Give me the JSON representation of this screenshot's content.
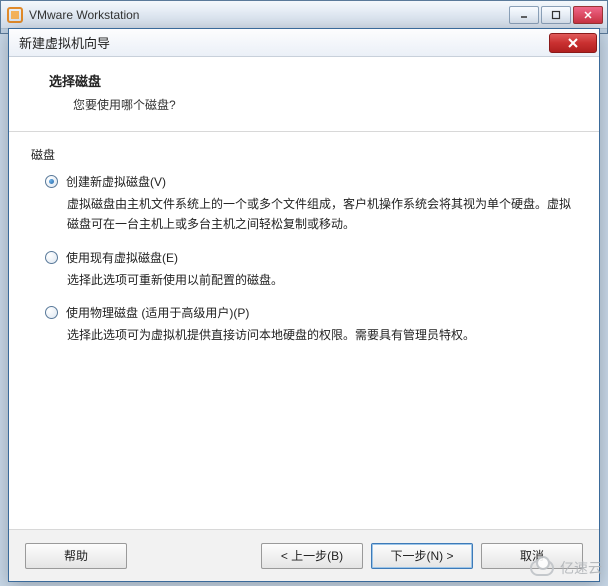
{
  "parent": {
    "title": "VMware Workstation"
  },
  "dialog": {
    "title": "新建虚拟机向导",
    "heading": "选择磁盘",
    "sub": "您要使用哪个磁盘?",
    "group_label": "磁盘",
    "options": [
      {
        "label": "创建新虚拟磁盘(V)",
        "desc": "虚拟磁盘由主机文件系统上的一个或多个文件组成，客户机操作系统会将其视为单个硬盘。虚拟磁盘可在一台主机上或多台主机之间轻松复制或移动。",
        "checked": true
      },
      {
        "label": "使用现有虚拟磁盘(E)",
        "desc": "选择此选项可重新使用以前配置的磁盘。",
        "checked": false
      },
      {
        "label": "使用物理磁盘 (适用于高级用户)(P)",
        "desc": "选择此选项可为虚拟机提供直接访问本地硬盘的权限。需要具有管理员特权。",
        "checked": false
      }
    ],
    "buttons": {
      "help": "帮助",
      "back": "< 上一步(B)",
      "next": "下一步(N) >",
      "cancel": "取消"
    }
  },
  "watermark": "亿速云"
}
